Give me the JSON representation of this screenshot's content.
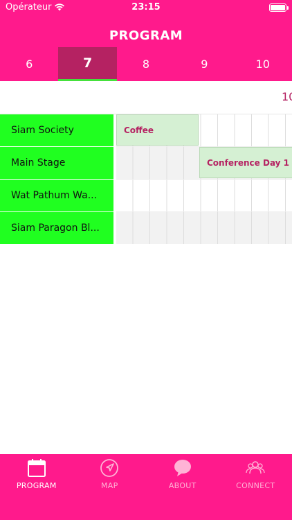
{
  "status": {
    "carrier": "Opérateur",
    "time": "23:15"
  },
  "header": {
    "title": "PROGRAM"
  },
  "days": [
    {
      "label": "6",
      "active": false
    },
    {
      "label": "7",
      "active": true
    },
    {
      "label": "8",
      "active": false
    },
    {
      "label": "9",
      "active": false
    },
    {
      "label": "10",
      "active": false
    }
  ],
  "timeline": {
    "hour_label": "10"
  },
  "venues": [
    {
      "name": "Siam Society"
    },
    {
      "name": "Main Stage"
    },
    {
      "name": "Wat Pathum Wa..."
    },
    {
      "name": "Siam Paragon Bl..."
    }
  ],
  "events": [
    {
      "title": "Coffee",
      "venue": "Siam Society"
    },
    {
      "title": "Conference Day 1",
      "venue": "Main Stage"
    }
  ],
  "tabs": [
    {
      "label": "PROGRAM",
      "icon": "calendar-icon",
      "active": true
    },
    {
      "label": "MAP",
      "icon": "navigation-arrow-icon",
      "active": false
    },
    {
      "label": "ABOUT",
      "icon": "speech-bubble-icon",
      "active": false
    },
    {
      "label": "CONNECT",
      "icon": "people-icon",
      "active": false
    }
  ],
  "colors": {
    "brand": "#ff1a8c",
    "active_day": "#b52262",
    "venue_bg": "#20ff20",
    "event_bg": "#d5f0d3",
    "event_text": "#b52262"
  }
}
